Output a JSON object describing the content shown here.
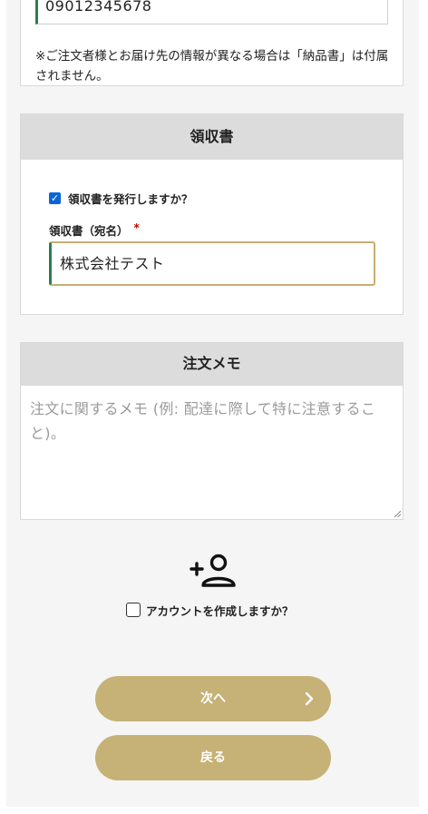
{
  "shipping": {
    "phone_value": "09012345678",
    "note": "※ご注文者様とお届け先の情報が異なる場合は「納品書」は付属されません。"
  },
  "receipt": {
    "heading": "領収書",
    "issue_checkbox_label": "領収書を発行しますか？",
    "issue_checked": true,
    "addressee_label": "領収書（宛名）",
    "required_mark": "*",
    "addressee_value": "株式会社テスト"
  },
  "memo": {
    "heading": "注文メモ",
    "placeholder": "注文に関するメモ (例: 配達に際して特に注意すること)。"
  },
  "account": {
    "icon": "person-add-icon",
    "create_label": "アカウントを作成しますか？",
    "create_checked": false
  },
  "buttons": {
    "next_label": "次へ",
    "next_icon": "chevron-right-icon",
    "back_label": "戻る"
  },
  "colors": {
    "button": "#c6b176",
    "input_border": "#c8ad72",
    "input_accent": "#2e7d4f",
    "checkbox": "#0a66d8",
    "required": "#c00000"
  }
}
